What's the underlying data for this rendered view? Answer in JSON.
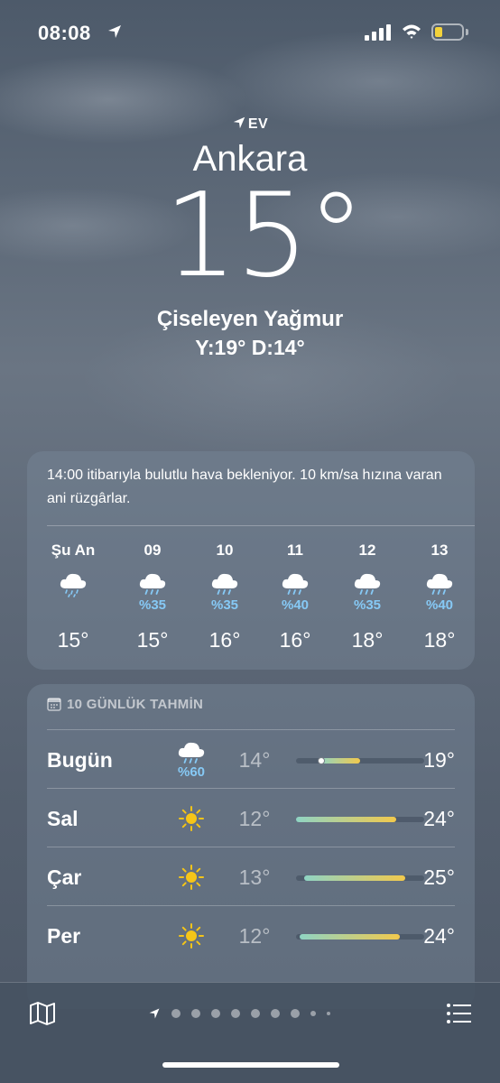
{
  "status_bar": {
    "time": "08:08"
  },
  "header": {
    "home_label": "EV",
    "city": "Ankara",
    "temperature": "15°",
    "condition": "Çiseleyen Yağmur",
    "high_low": "Y:19° D:14°"
  },
  "hourly": {
    "summary": "14:00 itibarıyla bulutlu hava bekleniyor. 10 km/sa hızına varan ani rüzgârlar.",
    "items": [
      {
        "label": "Şu An",
        "icon": "drizzle-cloud-icon",
        "prob": "",
        "temp": "15°"
      },
      {
        "label": "09",
        "icon": "rain-cloud-icon",
        "prob": "%35",
        "temp": "15°"
      },
      {
        "label": "10",
        "icon": "rain-cloud-icon",
        "prob": "%35",
        "temp": "16°"
      },
      {
        "label": "11",
        "icon": "rain-cloud-icon",
        "prob": "%40",
        "temp": "16°"
      },
      {
        "label": "12",
        "icon": "rain-cloud-icon",
        "prob": "%35",
        "temp": "18°"
      },
      {
        "label": "13",
        "icon": "rain-cloud-icon",
        "prob": "%40",
        "temp": "18°"
      }
    ]
  },
  "daily": {
    "header": "10 GÜNLÜK TAHMİN",
    "days": [
      {
        "name": "Bugün",
        "icon": "rain-cloud-icon",
        "prob": "%60",
        "low": "14°",
        "high": "19°",
        "range_start": 0.18,
        "range_end": 0.5,
        "current": 0.2
      },
      {
        "name": "Sal",
        "icon": "sun-icon",
        "prob": "",
        "low": "12°",
        "high": "24°",
        "range_start": 0.0,
        "range_end": 0.78
      },
      {
        "name": "Çar",
        "icon": "sun-icon",
        "prob": "",
        "low": "13°",
        "high": "25°",
        "range_start": 0.06,
        "range_end": 0.85
      },
      {
        "name": "Per",
        "icon": "sun-icon",
        "prob": "",
        "low": "12°",
        "high": "24°",
        "range_start": 0.03,
        "range_end": 0.81
      }
    ]
  },
  "colors": {
    "precip": "#86c9f5",
    "sun": "#f5c518",
    "bar_cool": "#8fd4c4",
    "bar_warm": "#f2c94c"
  }
}
